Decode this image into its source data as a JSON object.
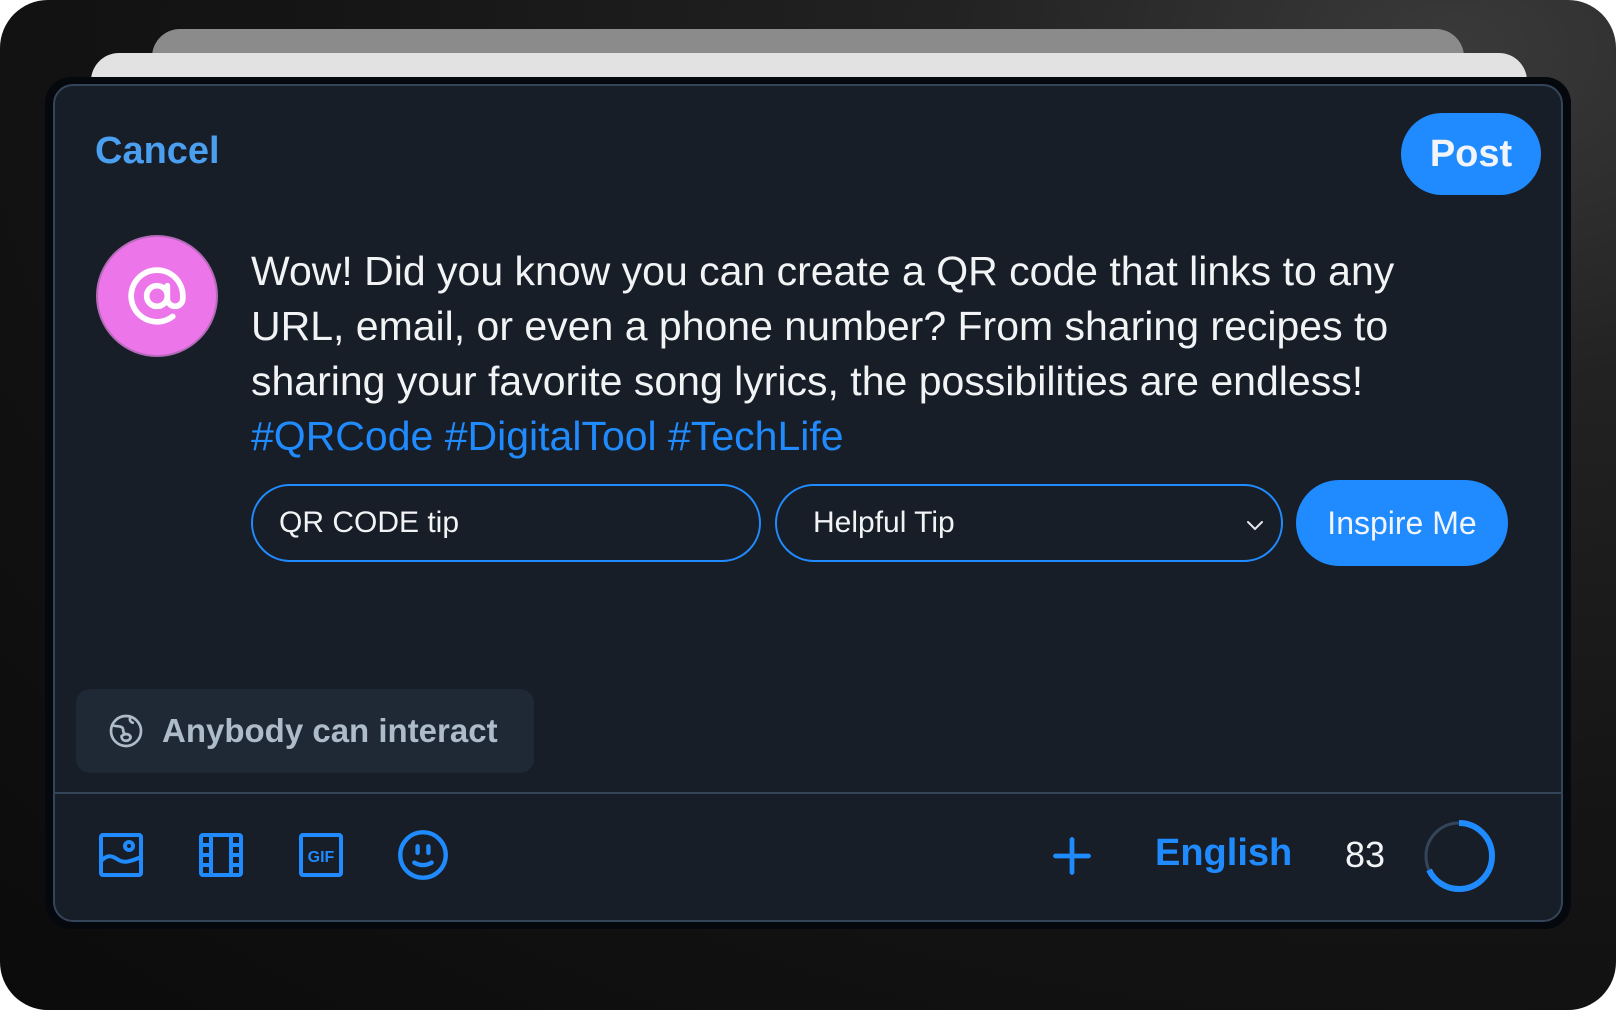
{
  "composer": {
    "cancel_label": "Cancel",
    "post_label": "Post",
    "avatar_symbol": "@",
    "post_text": "Wow! Did you know you can create a QR code that links to any URL, email, or even a phone number? From sharing recipes to sharing your favorite song lyrics, the possibilities are endless!",
    "hashtags": "#QRCode #DigitalTool #TechLife",
    "topic_input": {
      "value": "QR CODE tip"
    },
    "tone_select": {
      "selected": "Helpful Tip"
    },
    "inspire_label": "Inspire Me",
    "interaction_setting": "Anybody can interact"
  },
  "toolbar": {
    "icons": [
      "image-icon",
      "video-icon",
      "gif-icon",
      "emoji-icon"
    ],
    "add_icon": "plus-icon",
    "language": "English",
    "chars_remaining": "83",
    "char_progress_fraction": 0.68
  },
  "colors": {
    "accent": "#208bfe",
    "background": "#171e27",
    "avatar": "#ec75ea",
    "text": "#f1f3f5",
    "muted": "#aebbc9"
  }
}
